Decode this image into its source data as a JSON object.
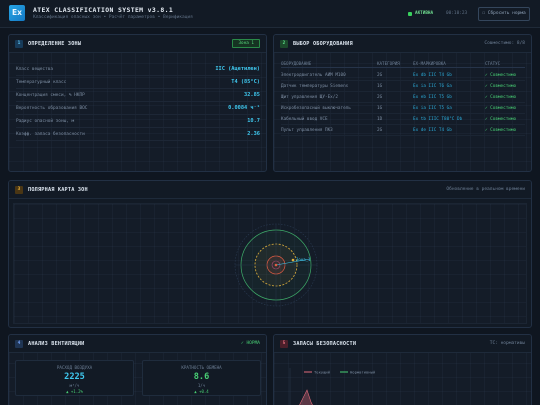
{
  "header": {
    "logo": "Ex",
    "title": "ATEX CLASSIFICATION SYSTEM v3.8.1",
    "subtitle": "Классификация опасных зон • Расчёт параметров • Верификация",
    "status": "АКТИВНА",
    "clock": "00:10:23",
    "reset_button": "Сбросить норма"
  },
  "colors": {
    "accent": "#3fc9f0",
    "ok": "#48cf74",
    "panel_bg": "#141c28",
    "zone0": "#e05c44",
    "zone1": "#e3b23c",
    "zone2": "#3fae6a"
  },
  "zone_panel": {
    "num": "1",
    "title": "ОПРЕДЕЛЕНИЕ ЗОНЫ",
    "tag": "Зона 1",
    "params": [
      {
        "label": "Класс вещества",
        "value": "IIC (Ацетилен)"
      },
      {
        "label": "Температурный класс",
        "value": "T4 (85°C)"
      },
      {
        "label": "Концентрация смеси, % НКПР",
        "value": "32.85"
      },
      {
        "label": "Вероятность образования ВОС",
        "value": "0.0084 ч⁻¹"
      },
      {
        "label": "Радиус опасной зоны, м",
        "value": "10.7"
      },
      {
        "label": "Коэфф. запаса безопасности",
        "value": "2.36"
      }
    ]
  },
  "equipment_panel": {
    "num": "2",
    "title": "ВЫБОР ОБОРУДОВАНИЯ",
    "right": "Совместимо: 8/8",
    "columns": [
      "ОБОРУДОВАНИЕ",
      "КАТЕГОРИЯ",
      "EX-МАРКИРОВКА",
      "СТАТУС"
    ],
    "rows": [
      {
        "name": "Электродвигатель АИМ М100",
        "cat": "2G",
        "mark": "Ex db IIC T4 Gb",
        "status": "✓ Совместимо"
      },
      {
        "name": "Датчик температуры Siemens",
        "cat": "1G",
        "mark": "Ex ia IIC T6 Ga",
        "status": "✓ Совместимо"
      },
      {
        "name": "Щит управления ЩУ-Ex/2",
        "cat": "2G",
        "mark": "Ex eb IIC T5 Gb",
        "status": "✓ Совместимо"
      },
      {
        "name": "Искробезопасный выключатель",
        "cat": "1G",
        "mark": "Ex ia IIC T5 Ga",
        "status": "✓ Совместимо"
      },
      {
        "name": "Кабельный ввод VCE",
        "cat": "1D",
        "mark": "Ex tb IIIC T80°C Db",
        "status": "✓ Совместимо"
      },
      {
        "name": "Пульт управления ПКЗ",
        "cat": "2G",
        "mark": "Ex de IIC T4 Gb",
        "status": "✓ Совместимо"
      }
    ]
  },
  "map_panel": {
    "num": "3",
    "title": "ПОЛЯРНАЯ КАРТА ЗОН",
    "right": "Обновление в реальном времени",
    "marker_label": "Зона_1"
  },
  "vent_panel": {
    "num": "4",
    "title": "АНАЛИЗ ВЕНТИЛЯЦИИ",
    "status": "✓ НОРМА",
    "cards": [
      {
        "label": "РАСХОД ВОЗДУХА",
        "value": "2225",
        "unit": "м³/ч",
        "delta": "▲ +1.2%"
      },
      {
        "label": "КРАТНОСТЬ ОБМЕНА",
        "value": "8.6",
        "unit": "1/ч",
        "delta": "▲ +0.4"
      }
    ]
  },
  "safety_panel": {
    "num": "5",
    "title": "ЗАПАСЫ БЕЗОПАСНОСТИ",
    "right": "ТС: нормативы",
    "legend": [
      "Текущий",
      "Нормативный"
    ]
  }
}
